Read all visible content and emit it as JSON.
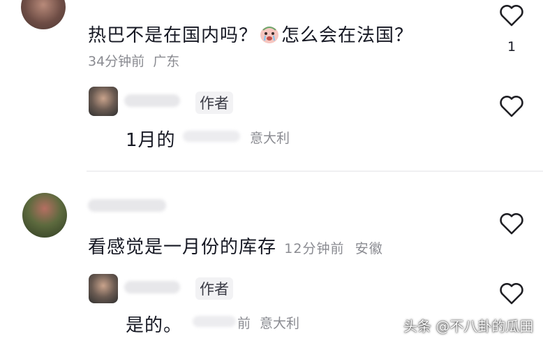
{
  "comments": [
    {
      "text_before": "热巴不是在国内吗？",
      "emoji_icon": "crying-face-icon",
      "text_after": "怎么会在法国？",
      "time": "34分钟前",
      "location": "广东",
      "like_count": "1",
      "reply": {
        "tag": "作者",
        "text": "1月的",
        "location": "意大利"
      }
    },
    {
      "text": "看感觉是一月份的库存",
      "time": "12分钟前",
      "location": "安徽",
      "reply": {
        "tag": "作者",
        "text": "是的。",
        "time_suffix": "前",
        "location": "意大利"
      }
    }
  ],
  "watermark": "头条 @不八卦的瓜田",
  "icons": {
    "like": "heart-outline-icon",
    "emoji": "crying-face-icon"
  },
  "colors": {
    "text": "#161823",
    "meta": "#8a8b91",
    "divider": "#f0f0f2"
  }
}
